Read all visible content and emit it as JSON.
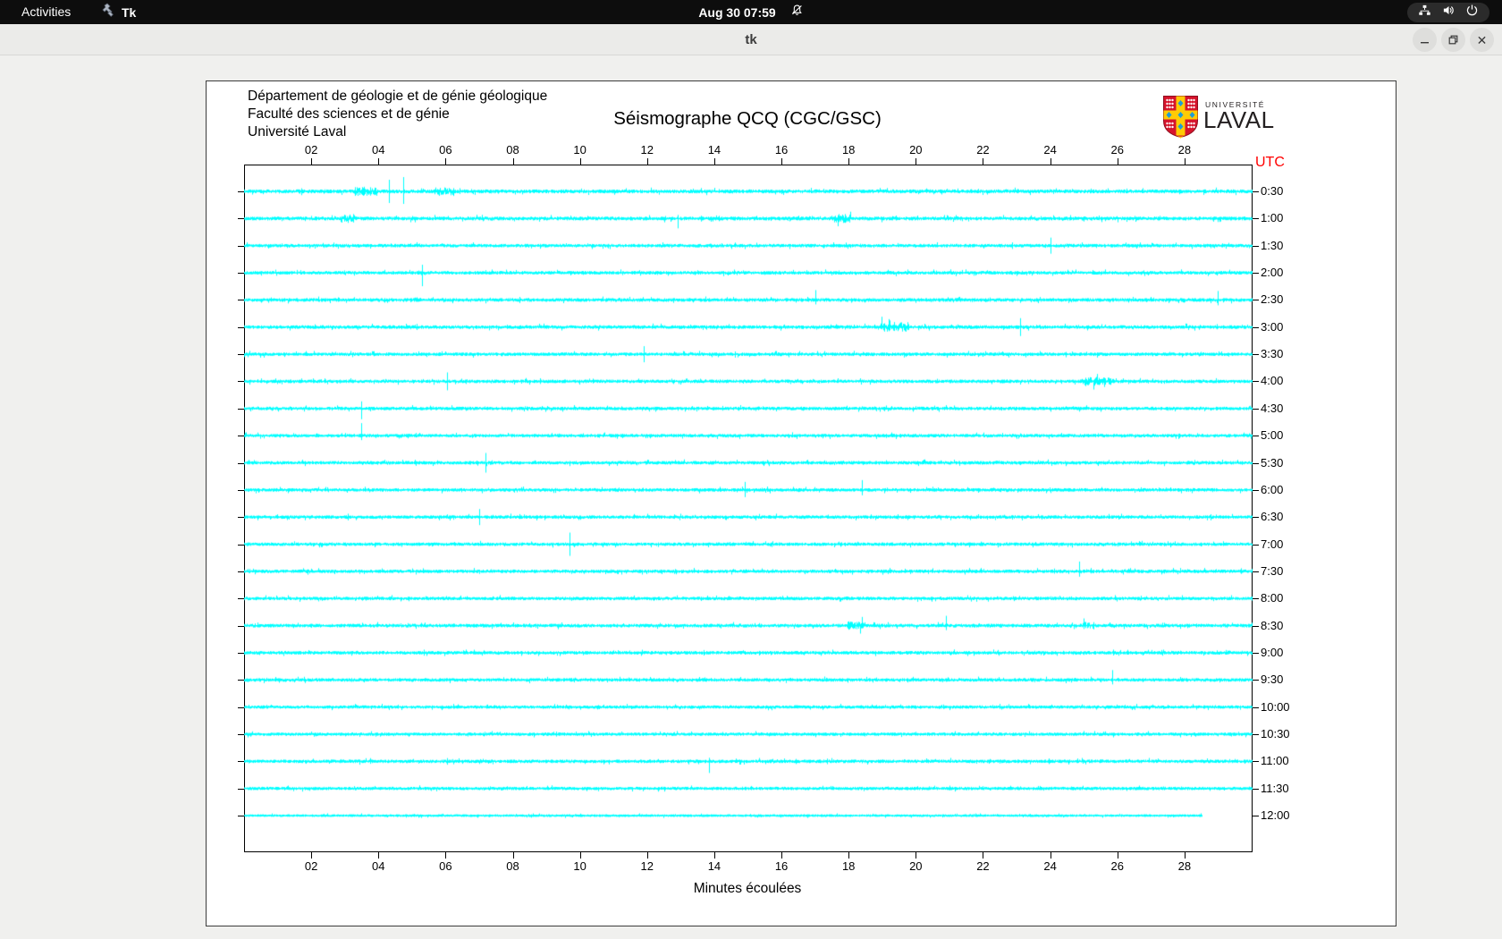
{
  "top_bar": {
    "activities_label": "Activities",
    "app_icon": "tk-icon",
    "app_name": "Tk",
    "clock": "Aug 30  07:59",
    "bell_icon": "bell-muted-icon",
    "system_icons": [
      "network-icon",
      "volume-icon",
      "power-icon"
    ]
  },
  "window": {
    "title": "tk",
    "controls": [
      "minimize",
      "maximize",
      "close"
    ]
  },
  "page": {
    "institution_lines": [
      "Département de géologie et de génie géologique",
      "Faculté des sciences et de génie",
      "Université Laval"
    ],
    "title": "Séismographe QCQ (CGC/GSC)",
    "utc_label": "UTC",
    "x_axis_label": "Minutes écoulées",
    "logo": {
      "upper": "UNIVERSITÉ",
      "name": "LAVAL"
    }
  },
  "colors": {
    "trace": "#00ffff",
    "utc_label": "#ff0000",
    "logo_red": "#d6142c",
    "logo_gold": "#ffcb05",
    "logo_blue": "#1e9cd7"
  },
  "chart_data": {
    "type": "line",
    "title": "Séismographe QCQ (CGC/GSC)",
    "xlabel": "Minutes écoulées",
    "x_range_minutes": [
      0,
      30
    ],
    "x_tick_labels": [
      "02",
      "04",
      "06",
      "08",
      "10",
      "12",
      "14",
      "16",
      "18",
      "20",
      "22",
      "24",
      "26",
      "28"
    ],
    "x_tick_minutes": [
      2,
      4,
      6,
      8,
      10,
      12,
      14,
      16,
      18,
      20,
      22,
      24,
      26,
      28
    ],
    "right_axis_label": "UTC",
    "row_time_labels": [
      "0:30",
      "1:00",
      "1:30",
      "2:00",
      "2:30",
      "3:00",
      "3:30",
      "4:00",
      "4:30",
      "5:00",
      "5:30",
      "6:00",
      "6:30",
      "7:00",
      "7:30",
      "8:00",
      "8:30",
      "9:00",
      "9:30",
      "10:00",
      "10:30",
      "11:00",
      "11:30",
      "12:00"
    ],
    "minutes_per_row": 30,
    "rows": [
      {
        "label": "0:30",
        "amp": 1.6,
        "end_min": 30,
        "spikes": [
          [
            4.3,
            13,
            13
          ],
          [
            4.75,
            16,
            14
          ]
        ],
        "blobs": [
          [
            3.25,
            3.95,
            3
          ],
          [
            5.65,
            6.25,
            3
          ]
        ]
      },
      {
        "label": "1:00",
        "amp": 1.6,
        "end_min": 30,
        "spikes": [
          [
            12.9,
            4,
            11
          ]
        ],
        "blobs": [
          [
            2.85,
            3.3,
            3
          ],
          [
            17.55,
            18.05,
            3
          ]
        ]
      },
      {
        "label": "1:30",
        "amp": 1.4,
        "end_min": 30,
        "spikes": [
          [
            24.0,
            9,
            9
          ]
        ],
        "blobs": []
      },
      {
        "label": "2:00",
        "amp": 1.4,
        "end_min": 30,
        "spikes": [
          [
            5.3,
            9,
            15
          ]
        ],
        "blobs": []
      },
      {
        "label": "2:30",
        "amp": 1.5,
        "end_min": 30,
        "spikes": [
          [
            17.0,
            11,
            5
          ],
          [
            29.0,
            10,
            6
          ]
        ],
        "blobs": []
      },
      {
        "label": "3:00",
        "amp": 1.5,
        "end_min": 30,
        "spikes": [
          [
            23.1,
            10,
            10
          ]
        ],
        "blobs": [
          [
            18.95,
            19.8,
            3.5
          ]
        ]
      },
      {
        "label": "3:30",
        "amp": 1.4,
        "end_min": 30,
        "spikes": [
          [
            11.9,
            9,
            9
          ]
        ],
        "blobs": []
      },
      {
        "label": "4:00",
        "amp": 1.4,
        "end_min": 30,
        "spikes": [
          [
            6.05,
            10,
            10
          ]
        ],
        "blobs": [
          [
            24.95,
            25.8,
            2.5
          ]
        ]
      },
      {
        "label": "4:30",
        "amp": 1.4,
        "end_min": 30,
        "spikes": [
          [
            3.5,
            8,
            12
          ]
        ],
        "blobs": []
      },
      {
        "label": "5:00",
        "amp": 1.4,
        "end_min": 30,
        "spikes": [
          [
            3.5,
            14,
            5
          ]
        ],
        "blobs": []
      },
      {
        "label": "5:30",
        "amp": 1.4,
        "end_min": 30,
        "spikes": [
          [
            7.2,
            11,
            11
          ]
        ],
        "blobs": []
      },
      {
        "label": "6:00",
        "amp": 1.4,
        "end_min": 30,
        "spikes": [
          [
            14.9,
            9,
            8
          ],
          [
            18.4,
            11,
            6
          ]
        ],
        "blobs": []
      },
      {
        "label": "6:30",
        "amp": 1.4,
        "end_min": 30,
        "spikes": [
          [
            7.0,
            9,
            9
          ]
        ],
        "blobs": []
      },
      {
        "label": "7:00",
        "amp": 1.4,
        "end_min": 30,
        "spikes": [
          [
            9.7,
            13,
            13
          ]
        ],
        "blobs": []
      },
      {
        "label": "7:30",
        "amp": 1.4,
        "end_min": 30,
        "spikes": [
          [
            24.85,
            11,
            6
          ]
        ],
        "blobs": []
      },
      {
        "label": "8:00",
        "amp": 1.4,
        "end_min": 30,
        "spikes": [],
        "blobs": []
      },
      {
        "label": "8:30",
        "amp": 1.5,
        "end_min": 30,
        "spikes": [
          [
            20.9,
            11,
            5
          ]
        ],
        "blobs": [
          [
            17.95,
            18.5,
            2.5
          ],
          [
            24.95,
            25.3,
            2.5
          ]
        ]
      },
      {
        "label": "9:00",
        "amp": 1.4,
        "end_min": 30,
        "spikes": [],
        "blobs": []
      },
      {
        "label": "9:30",
        "amp": 1.4,
        "end_min": 30,
        "spikes": [
          [
            25.85,
            11,
            5
          ]
        ],
        "blobs": []
      },
      {
        "label": "10:00",
        "amp": 1.3,
        "end_min": 30,
        "spikes": [],
        "blobs": []
      },
      {
        "label": "10:30",
        "amp": 1.3,
        "end_min": 30,
        "spikes": [],
        "blobs": []
      },
      {
        "label": "11:00",
        "amp": 1.4,
        "end_min": 30,
        "spikes": [
          [
            13.85,
            4,
            13
          ]
        ],
        "blobs": []
      },
      {
        "label": "11:30",
        "amp": 1.3,
        "end_min": 30,
        "spikes": [],
        "blobs": []
      },
      {
        "label": "12:00",
        "amp": 0.9,
        "end_min": 28.5,
        "spikes": [],
        "blobs": []
      }
    ]
  }
}
